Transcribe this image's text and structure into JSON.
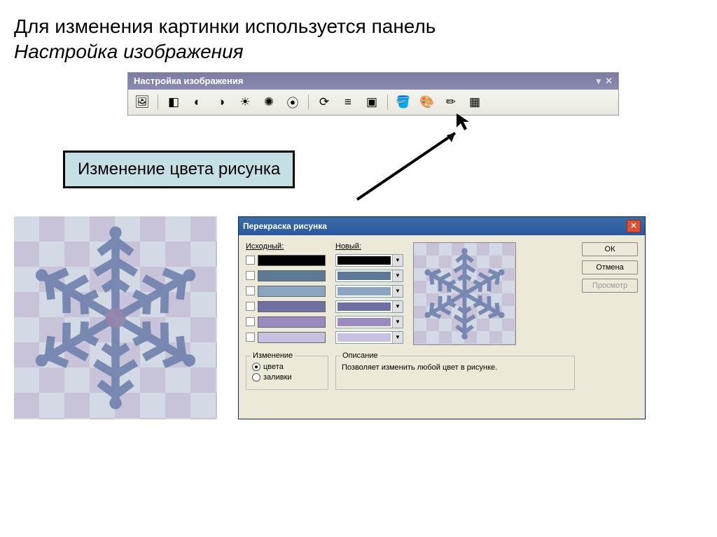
{
  "heading": {
    "line1": "Для изменения картинки используется панель",
    "line2": "Настройка изображения"
  },
  "toolbar": {
    "title": "Настройка изображения",
    "icons": [
      "insert-image-icon",
      "color-mode-icon",
      "contrast-up-icon",
      "contrast-down-icon",
      "brightness-up-icon",
      "brightness-down-icon",
      "crop-icon",
      "rotate-icon",
      "line-style-icon",
      "compress-icon",
      "recolor-icon",
      "transparent-icon",
      "reset-icon",
      "format-icon"
    ],
    "glyphs": [
      "🖼",
      "◧",
      "◐",
      "◑",
      "☀",
      "✺",
      "⦿",
      "⟳",
      "≡",
      "▣",
      "🪣",
      "🎨",
      "✏",
      "▦"
    ]
  },
  "label": "Изменение цвета рисунка",
  "dialog": {
    "title": "Перекраска рисунка",
    "col_original": "Исходный:",
    "col_new": "Новый:",
    "colors": [
      {
        "orig": "#000000",
        "new": "#000000"
      },
      {
        "orig": "#5a7a95",
        "new": "#5a7a95"
      },
      {
        "orig": "#8aa5c0",
        "new": "#8aa5c0"
      },
      {
        "orig": "#7070a5",
        "new": "#7070a5"
      },
      {
        "orig": "#9a8ac0",
        "new": "#9a8ac0"
      },
      {
        "orig": "#c8c0e0",
        "new": "#c8c0e0"
      }
    ],
    "group_change": "Изменение",
    "radio_colors": "цвета",
    "radio_fills": "заливки",
    "group_desc": "Описание",
    "desc_text": "Позволяет изменить любой цвет в рисунке.",
    "btn_ok": "ОК",
    "btn_cancel": "Отмена",
    "btn_preview": "Просмотр"
  }
}
